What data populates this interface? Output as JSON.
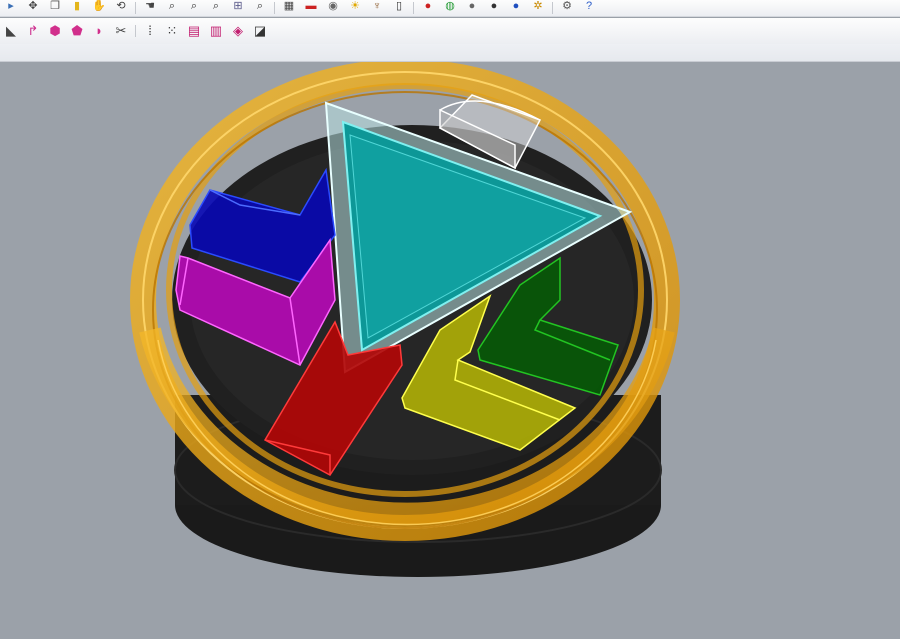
{
  "toolbars": {
    "top": [
      {
        "name": "cursor-icon",
        "glyph": "▸",
        "color": "#3a6fb5"
      },
      {
        "name": "move-icon",
        "glyph": "✥",
        "color": "#444"
      },
      {
        "name": "copy-icon",
        "glyph": "❐",
        "color": "#555"
      },
      {
        "name": "paste-icon",
        "glyph": "▮",
        "color": "#e3b51c"
      },
      {
        "name": "pan-icon",
        "glyph": "✋",
        "color": "#444"
      },
      {
        "name": "rotate-view-icon",
        "glyph": "⟲",
        "color": "#444"
      },
      {
        "name": "hand-icon",
        "glyph": "☚",
        "color": "#444"
      },
      {
        "name": "zoom-icon",
        "glyph": "⌕",
        "color": "#333"
      },
      {
        "name": "zoom-window-icon",
        "glyph": "⌕",
        "color": "#333"
      },
      {
        "name": "zoom-extents-icon",
        "glyph": "⌕",
        "color": "#333"
      },
      {
        "name": "zoom-selected-icon",
        "glyph": "⊞",
        "color": "#5a5a8a"
      },
      {
        "name": "zoom-target-icon",
        "glyph": "⌕",
        "color": "#333"
      },
      {
        "name": "grid-icon",
        "glyph": "▦",
        "color": "#444"
      },
      {
        "name": "car-icon",
        "glyph": "▬",
        "color": "#cc2222"
      },
      {
        "name": "camera-icon",
        "glyph": "◉",
        "color": "#666"
      },
      {
        "name": "light-icon",
        "glyph": "☀",
        "color": "#e0a800"
      },
      {
        "name": "lamp-icon",
        "glyph": "♆",
        "color": "#8b5a2b"
      },
      {
        "name": "layer-icon",
        "glyph": "▯",
        "color": "#333"
      },
      {
        "name": "material-icon",
        "glyph": "●",
        "color": "#cc2222"
      },
      {
        "name": "color-wheel-icon",
        "glyph": "◍",
        "color": "#2a9d3a"
      },
      {
        "name": "sphere-gray-icon",
        "glyph": "●",
        "color": "#666"
      },
      {
        "name": "sphere-dark-icon",
        "glyph": "●",
        "color": "#333"
      },
      {
        "name": "sphere-blue-icon",
        "glyph": "●",
        "color": "#1f4fbf"
      },
      {
        "name": "settings-icon",
        "glyph": "✲",
        "color": "#c98a00"
      },
      {
        "name": "options-icon",
        "glyph": "⚙",
        "color": "#555"
      },
      {
        "name": "help-icon",
        "glyph": "?",
        "color": "#2b5cc7"
      }
    ],
    "second": [
      {
        "name": "extrude-icon",
        "glyph": "◣",
        "color": "#444"
      },
      {
        "name": "sweep-icon",
        "glyph": "↱",
        "color": "#cc2a8c"
      },
      {
        "name": "box-icon",
        "glyph": "⬢",
        "color": "#d12f8c"
      },
      {
        "name": "solid-icon",
        "glyph": "⬟",
        "color": "#d12f8c"
      },
      {
        "name": "fillet-icon",
        "glyph": "◗",
        "color": "#d12f8c"
      },
      {
        "name": "cut-icon",
        "glyph": "✂",
        "color": "#444"
      },
      {
        "name": "points-icon",
        "glyph": "⁞",
        "color": "#333"
      },
      {
        "name": "point-grid-icon",
        "glyph": "⁙",
        "color": "#333"
      },
      {
        "name": "mesh-icon",
        "glyph": "▤",
        "color": "#c21d6f"
      },
      {
        "name": "mesh-edit-icon",
        "glyph": "▥",
        "color": "#c21d6f"
      },
      {
        "name": "surface-icon",
        "glyph": "◈",
        "color": "#c21d6f"
      },
      {
        "name": "eraser-icon",
        "glyph": "◪",
        "color": "#333"
      }
    ]
  },
  "colors": {
    "ring": "#f0aa14",
    "base": "#1b1b1b",
    "triangle": "#19a3a3",
    "blue": "#1010b8",
    "magenta": "#c218c2",
    "red": "#c80f0f",
    "yellow": "#c9c90d",
    "green": "#0b6e0b",
    "white": "#f2f2f2"
  }
}
